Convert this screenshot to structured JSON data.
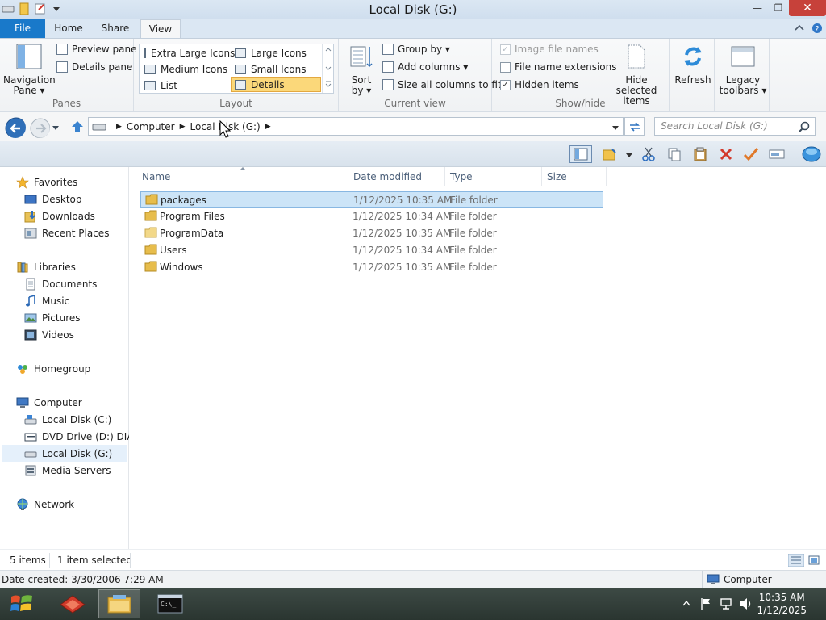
{
  "window": {
    "title": "Local Disk (G:)",
    "controls": {
      "minimize": "—",
      "maximize": "❐",
      "close": "✕"
    }
  },
  "ribbon": {
    "tabs": [
      {
        "label": "File"
      },
      {
        "label": "Home"
      },
      {
        "label": "Share"
      },
      {
        "label": "View"
      }
    ],
    "panes": {
      "label": "Panes",
      "navigation_pane": "Navigation",
      "navigation_pane_2": "Pane ▾",
      "preview_pane": "Preview pane",
      "details_pane": "Details pane"
    },
    "layout": {
      "label": "Layout",
      "options": [
        {
          "label": "Extra Large Icons"
        },
        {
          "label": "Large Icons"
        },
        {
          "label": "Medium Icons"
        },
        {
          "label": "Small Icons"
        },
        {
          "label": "List"
        },
        {
          "label": "Details",
          "selected": true
        }
      ]
    },
    "current_view": {
      "label": "Current view",
      "sort_by": "Sort",
      "sort_by_2": "by ▾",
      "group_by": "Group by ▾",
      "add_columns": "Add columns ▾",
      "size_all_columns": "Size all columns to fit"
    },
    "show_hide": {
      "label": "Show/hide",
      "image_file_names": {
        "label": "Image file names",
        "checked": true,
        "disabled": true
      },
      "file_name_extensions": {
        "label": "File name extensions",
        "checked": false
      },
      "hidden_items": {
        "label": "Hidden items",
        "checked": true
      },
      "hide_selected": "Hide selected",
      "hide_selected_2": "items"
    },
    "refresh": "Refresh",
    "legacy": "Legacy",
    "legacy_2": "toolbars ▾"
  },
  "address": {
    "crumbs": [
      "Computer",
      "Local Disk (G:)"
    ],
    "search_placeholder": "Search Local Disk (G:)"
  },
  "nav": {
    "favorites": "Favorites",
    "desktop": "Desktop",
    "downloads": "Downloads",
    "recent_places": "Recent Places",
    "libraries": "Libraries",
    "documents": "Documents",
    "music": "Music",
    "pictures": "Pictures",
    "videos": "Videos",
    "homegroup": "Homegroup",
    "computer": "Computer",
    "local_c": "Local Disk (C:)",
    "dvd_d": "DVD Drive (D:) DIATI",
    "local_g": "Local Disk (G:)",
    "media_servers": "Media Servers",
    "network": "Network"
  },
  "columns": {
    "name": "Name",
    "date": "Date modified",
    "type": "Type",
    "size": "Size"
  },
  "files": [
    {
      "name": "packages",
      "date": "1/12/2025 10:35 AM",
      "type": "File folder",
      "size": ""
    },
    {
      "name": "Program Files",
      "date": "1/12/2025 10:34 AM",
      "type": "File folder",
      "size": ""
    },
    {
      "name": "ProgramData",
      "date": "1/12/2025 10:35 AM",
      "type": "File folder",
      "size": ""
    },
    {
      "name": "Users",
      "date": "1/12/2025 10:34 AM",
      "type": "File folder",
      "size": ""
    },
    {
      "name": "Windows",
      "date": "1/12/2025 10:35 AM",
      "type": "File folder",
      "size": ""
    }
  ],
  "status": {
    "item_count": "5 items",
    "selected": "1 item selected",
    "date_created": "Date created: 3/30/2006 7:29 AM",
    "location": "Computer"
  },
  "taskbar": {
    "time": "10:35 AM",
    "date": "1/12/2025"
  },
  "colors": {
    "accent": "#1979ca",
    "selection": "#cce4f7",
    "close": "#c7413a"
  }
}
